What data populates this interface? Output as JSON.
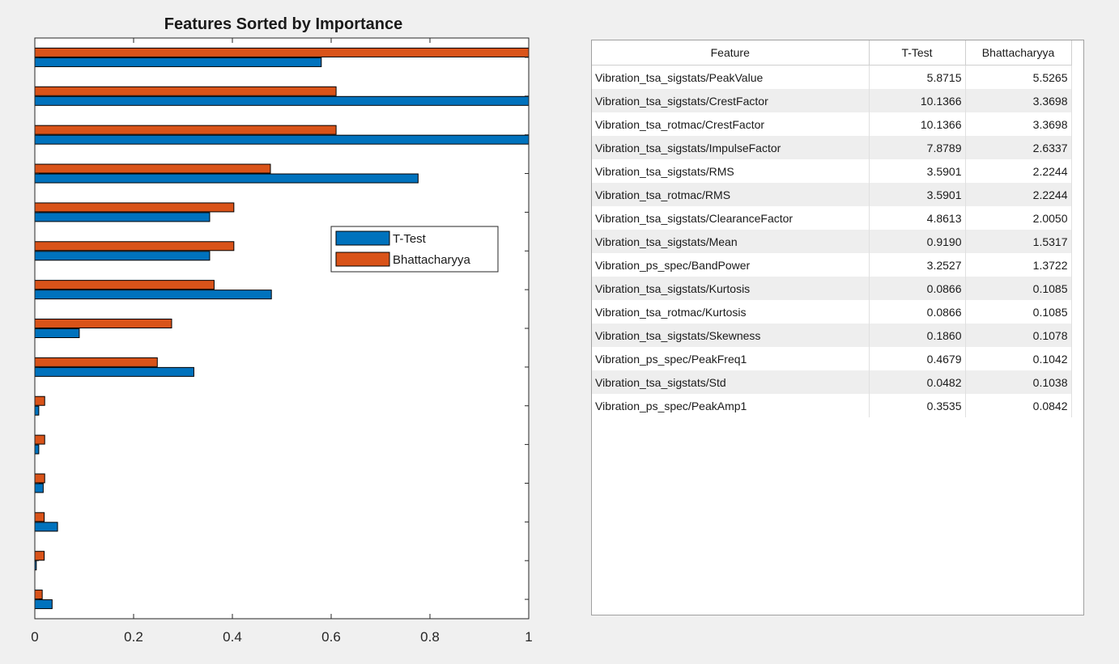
{
  "chart_data": {
    "type": "bar",
    "orientation": "horizontal",
    "title": "Features Sorted by Importance",
    "xlim": [
      0,
      1
    ],
    "xticks": [
      "0",
      "0.2",
      "0.4",
      "0.6",
      "0.8",
      "1"
    ],
    "legend": [
      "T-Test",
      "Bhattacharyya"
    ],
    "legend_placement": "center-right",
    "colors": {
      "ttest": "#0072bd",
      "bhatt": "#d95319"
    },
    "series": [
      {
        "name": "T-Test",
        "values": [
          0.58,
          1.0,
          1.0,
          0.776,
          0.354,
          0.354,
          0.479,
          0.09,
          0.322,
          0.008,
          0.008,
          0.017,
          0.046,
          0.003,
          0.035
        ]
      },
      {
        "name": "Bhattacharyya",
        "values": [
          1.0,
          0.61,
          0.61,
          0.477,
          0.403,
          0.403,
          0.363,
          0.277,
          0.248,
          0.02,
          0.02,
          0.02,
          0.019,
          0.019,
          0.015
        ]
      }
    ]
  },
  "table": {
    "columns": [
      "Feature",
      "T-Test",
      "Bhattacharyya"
    ],
    "rows": [
      [
        "Vibration_tsa_sigstats/PeakValue",
        "5.8715",
        "5.5265"
      ],
      [
        "Vibration_tsa_sigstats/CrestFactor",
        "10.1366",
        "3.3698"
      ],
      [
        "Vibration_tsa_rotmac/CrestFactor",
        "10.1366",
        "3.3698"
      ],
      [
        "Vibration_tsa_sigstats/ImpulseFactor",
        "7.8789",
        "2.6337"
      ],
      [
        "Vibration_tsa_sigstats/RMS",
        "3.5901",
        "2.2244"
      ],
      [
        "Vibration_tsa_rotmac/RMS",
        "3.5901",
        "2.2244"
      ],
      [
        "Vibration_tsa_sigstats/ClearanceFactor",
        "4.8613",
        "2.0050"
      ],
      [
        "Vibration_tsa_sigstats/Mean",
        "0.9190",
        "1.5317"
      ],
      [
        "Vibration_ps_spec/BandPower",
        "3.2527",
        "1.3722"
      ],
      [
        "Vibration_tsa_sigstats/Kurtosis",
        "0.0866",
        "0.1085"
      ],
      [
        "Vibration_tsa_rotmac/Kurtosis",
        "0.0866",
        "0.1085"
      ],
      [
        "Vibration_tsa_sigstats/Skewness",
        "0.1860",
        "0.1078"
      ],
      [
        "Vibration_ps_spec/PeakFreq1",
        "0.4679",
        "0.1042"
      ],
      [
        "Vibration_tsa_sigstats/Std",
        "0.0482",
        "0.1038"
      ],
      [
        "Vibration_ps_spec/PeakAmp1",
        "0.3535",
        "0.0842"
      ]
    ]
  }
}
